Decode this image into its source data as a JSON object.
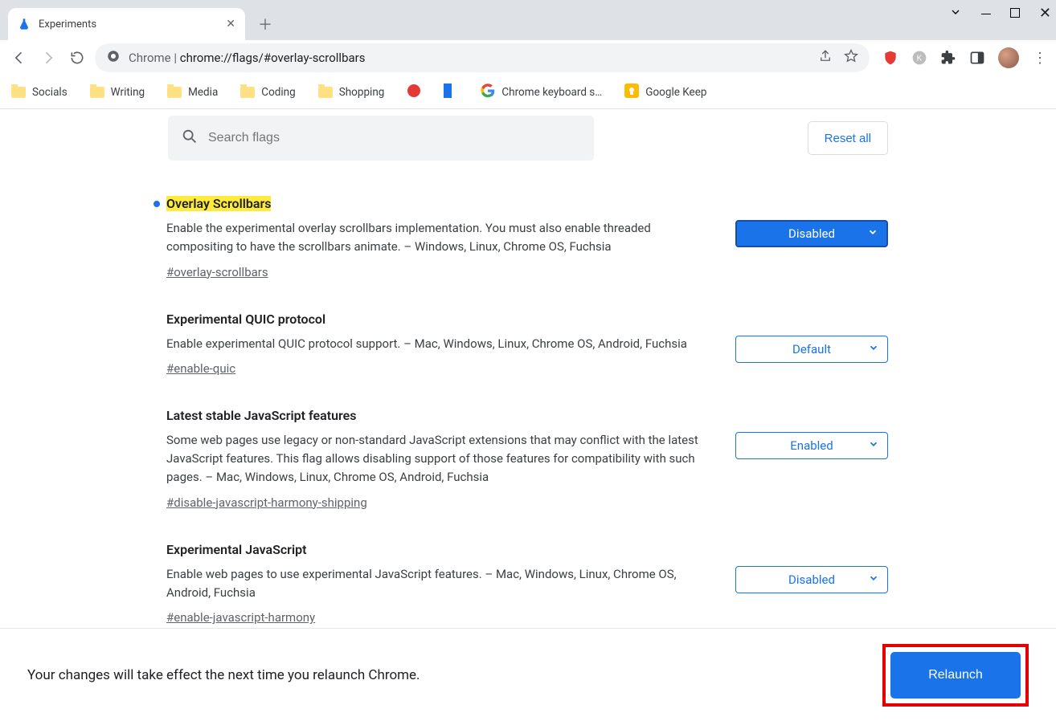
{
  "window": {
    "tab_title": "Experiments"
  },
  "omnibox": {
    "prefix": "Chrome",
    "url": "chrome://flags/#overlay-scrollbars"
  },
  "bookmarks": [
    {
      "label": "Socials",
      "kind": "folder"
    },
    {
      "label": "Writing",
      "kind": "folder"
    },
    {
      "label": "Media",
      "kind": "folder"
    },
    {
      "label": "Coding",
      "kind": "folder"
    },
    {
      "label": "Shopping",
      "kind": "folder"
    },
    {
      "label": "",
      "kind": "icon-red"
    },
    {
      "label": "",
      "kind": "icon-blue"
    },
    {
      "label": "Chrome keyboard s…",
      "kind": "google"
    },
    {
      "label": "Google Keep",
      "kind": "keep"
    }
  ],
  "search": {
    "placeholder": "Search flags"
  },
  "reset_label": "Reset all",
  "flags": [
    {
      "title": "Overlay Scrollbars",
      "description": "Enable the experimental overlay scrollbars implementation. You must also enable threaded compositing to have the scrollbars animate. – Windows, Linux, Chrome OS, Fuchsia",
      "anchor": "#overlay-scrollbars",
      "value": "Disabled",
      "changed": true,
      "highlight": true
    },
    {
      "title": "Experimental QUIC protocol",
      "description": "Enable experimental QUIC protocol support. – Mac, Windows, Linux, Chrome OS, Android, Fuchsia",
      "anchor": "#enable-quic",
      "value": "Default",
      "changed": false,
      "highlight": false
    },
    {
      "title": "Latest stable JavaScript features",
      "description": "Some web pages use legacy or non-standard JavaScript extensions that may conflict with the latest JavaScript features. This flag allows disabling support of those features for compatibility with such pages. – Mac, Windows, Linux, Chrome OS, Android, Fuchsia",
      "anchor": "#disable-javascript-harmony-shipping",
      "value": "Enabled",
      "changed": false,
      "highlight": false
    },
    {
      "title": "Experimental JavaScript",
      "description": "Enable web pages to use experimental JavaScript features. – Mac, Windows, Linux, Chrome OS, Android, Fuchsia",
      "anchor": "#enable-javascript-harmony",
      "value": "Disabled",
      "changed": false,
      "highlight": false
    }
  ],
  "relaunch": {
    "message": "Your changes will take effect the next time you relaunch Chrome.",
    "button": "Relaunch"
  }
}
